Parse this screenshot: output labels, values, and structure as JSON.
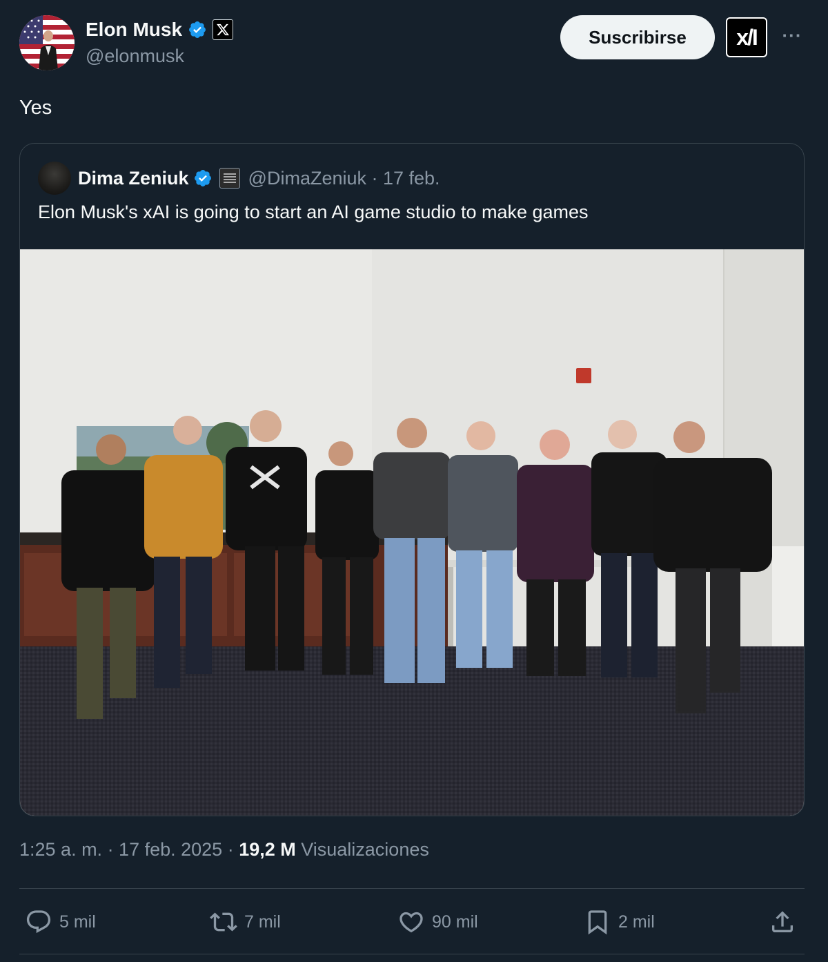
{
  "author": {
    "name": "Elon Musk",
    "handle": "@elonmusk"
  },
  "header": {
    "subscribe_label": "Suscribirse",
    "affiliate_logo_text": "x/I",
    "more_label": "···"
  },
  "tweet": {
    "text": "Yes"
  },
  "quote": {
    "name": "Dima Zeniuk",
    "meta": "@DimaZeniuk · 17 feb.",
    "text": "Elon Musk's xAI is going to start an AI game studio to make games"
  },
  "timestamp": {
    "time": "1:25 a. m. · 17 feb. 2025 · ",
    "views_count": "19,2 M",
    "views_label": " Visualizaciones"
  },
  "actions": {
    "replies": "5 mil",
    "reposts": "7 mil",
    "likes": "90 mil",
    "bookmarks": "2 mil"
  },
  "colors": {
    "background": "#15202b",
    "verified": "#1d9bf0",
    "secondary_text": "#8b98a5",
    "border": "#38444d"
  },
  "icons": [
    "verified-icon",
    "x-icon",
    "more-icon",
    "reply-icon",
    "repost-icon",
    "like-icon",
    "bookmark-icon",
    "share-icon"
  ]
}
